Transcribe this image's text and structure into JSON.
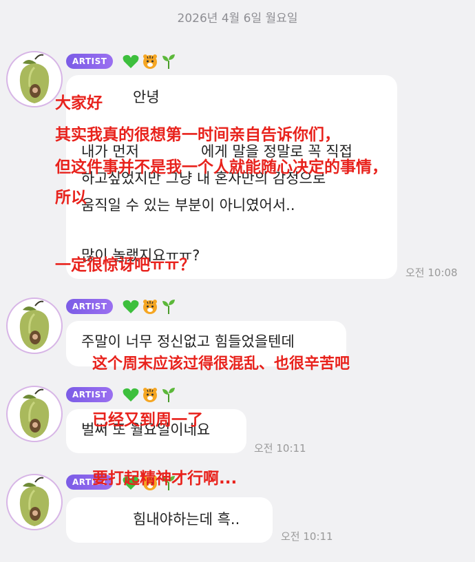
{
  "date_header": "2026년 4월 6일 월요일",
  "badge_label": "ARTIST",
  "icons": [
    "green-heart-icon",
    "tiger-icon",
    "sprout-icon"
  ],
  "colors": {
    "badge": "#8a63ec",
    "overlay_text": "#e8221c",
    "background": "#f1f1f3",
    "bubble": "#ffffff"
  },
  "messages": [
    {
      "lines": [
        "안녕",
        "내가 먼저",
        "에게 말을 정말로 꼭 직접",
        "하고싶었지만 그냥 내 혼자만의 감정으로",
        "움직일 수 있는 부분이 아니였어서..",
        "많이 놀랬지요ㅠㅠ?"
      ],
      "time": "오전 10:08"
    },
    {
      "lines": [
        "주말이 너무 정신없고 힘들었을텐데"
      ],
      "time": ""
    },
    {
      "lines": [
        "벌써 또 월요일이네요"
      ],
      "time": "오전 10:11"
    },
    {
      "lines": [
        "힘내야하는데 흑.."
      ],
      "time": "오전 10:11"
    }
  ],
  "translations": {
    "t1": "大家好",
    "t2": "其实我真的很想第一时间亲自告诉你们，",
    "t3": "但这件事并不是我一个人就能随心决定的事情，",
    "t4": "所以",
    "t5": "一定很惊讶吧ㅠㅠ？",
    "t6": "这个周末应该过得很混乱、也很辛苦吧",
    "t7": "已经又到周一了",
    "t8": "要打起精神才行啊..."
  }
}
